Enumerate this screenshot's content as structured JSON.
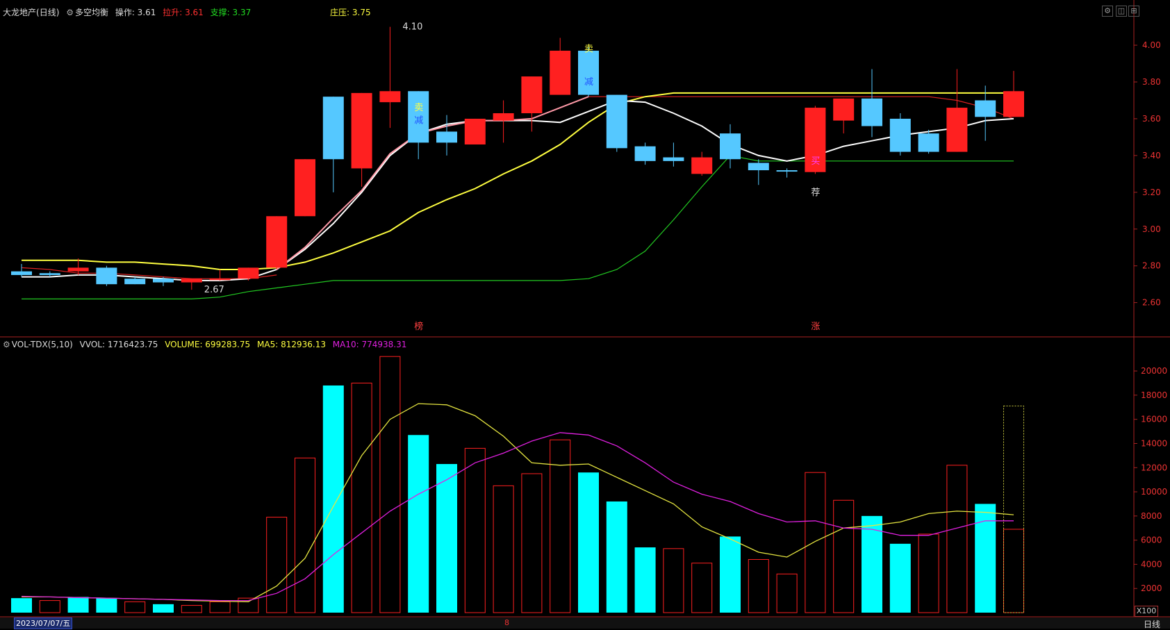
{
  "main_header": {
    "stock": "大龙地产",
    "period": "(日线)",
    "indicator": "多空均衡",
    "operate": "操作: 3.61",
    "pull": "拉升: 3.61",
    "support": "支撑: 3.37",
    "dealer": "庄压: 3.75"
  },
  "vol_header": {
    "name": "VOL-TDX(5,10)",
    "vvol": "VVOL: 1716423.75",
    "volume": "VOLUME: 699283.75",
    "ma5": "MA5: 812936.13",
    "ma10": "MA10: 774938.31"
  },
  "footer": {
    "date": "2023/07/07/五",
    "month_tick": "8",
    "period_label": "日线",
    "unit": "X100"
  },
  "colors": {
    "up": "#ff2020",
    "down": "#55c8ff",
    "vol_down": "#00ffff",
    "ma_white": "#ffffff",
    "ma_yellow": "#ffff40",
    "support_green": "#22cc22",
    "ma5": "#e6e640",
    "ma10": "#e020e0",
    "axis": "#aa2222"
  },
  "chart_data": [
    {
      "type": "candlestick",
      "title": "大龙地产 (日线) 多空均衡",
      "ylim": [
        2.44,
        4.14
      ],
      "y_ticks": [
        2.6,
        2.8,
        3.0,
        3.2,
        3.4,
        3.6,
        3.8,
        4.0
      ],
      "y_tick_labels": [
        "2.60",
        "2.80",
        "3.00",
        "3.20",
        "3.40",
        "3.60",
        "3.80",
        "4.00"
      ],
      "candles": [
        {
          "o": 2.77,
          "h": 2.81,
          "l": 2.74,
          "c": 2.75,
          "dir": "down"
        },
        {
          "o": 2.76,
          "h": 2.77,
          "l": 2.74,
          "c": 2.75,
          "dir": "down"
        },
        {
          "o": 2.79,
          "h": 2.84,
          "l": 2.75,
          "c": 2.77,
          "dir": "up"
        },
        {
          "o": 2.79,
          "h": 2.8,
          "l": 2.69,
          "c": 2.7,
          "dir": "down"
        },
        {
          "o": 2.73,
          "h": 2.74,
          "l": 2.7,
          "c": 2.7,
          "dir": "down"
        },
        {
          "o": 2.73,
          "h": 2.74,
          "l": 2.69,
          "c": 2.71,
          "dir": "down"
        },
        {
          "o": 2.71,
          "h": 2.73,
          "l": 2.67,
          "c": 2.73,
          "dir": "up"
        },
        {
          "o": 2.73,
          "h": 2.78,
          "l": 2.72,
          "c": 2.73,
          "dir": "up"
        },
        {
          "o": 2.73,
          "h": 2.79,
          "l": 2.72,
          "c": 2.79,
          "dir": "up"
        },
        {
          "o": 2.79,
          "h": 3.07,
          "l": 2.78,
          "c": 3.07,
          "dir": "up"
        },
        {
          "o": 3.07,
          "h": 3.38,
          "l": 3.07,
          "c": 3.38,
          "dir": "up"
        },
        {
          "o": 3.72,
          "h": 3.72,
          "l": 3.2,
          "c": 3.38,
          "dir": "down"
        },
        {
          "o": 3.33,
          "h": 3.74,
          "l": 3.23,
          "c": 3.74,
          "dir": "up"
        },
        {
          "o": 3.69,
          "h": 4.1,
          "l": 3.55,
          "c": 3.75,
          "dir": "up"
        },
        {
          "o": 3.75,
          "h": 3.75,
          "l": 3.38,
          "c": 3.47,
          "dir": "down"
        },
        {
          "o": 3.53,
          "h": 3.62,
          "l": 3.4,
          "c": 3.47,
          "dir": "down"
        },
        {
          "o": 3.46,
          "h": 3.6,
          "l": 3.46,
          "c": 3.6,
          "dir": "up"
        },
        {
          "o": 3.59,
          "h": 3.7,
          "l": 3.47,
          "c": 3.63,
          "dir": "up"
        },
        {
          "o": 3.63,
          "h": 3.83,
          "l": 3.53,
          "c": 3.83,
          "dir": "up"
        },
        {
          "o": 3.73,
          "h": 4.04,
          "l": 3.73,
          "c": 3.97,
          "dir": "up"
        },
        {
          "o": 3.97,
          "h": 3.99,
          "l": 3.72,
          "c": 3.73,
          "dir": "down"
        },
        {
          "o": 3.73,
          "h": 3.73,
          "l": 3.42,
          "c": 3.44,
          "dir": "down"
        },
        {
          "o": 3.45,
          "h": 3.47,
          "l": 3.35,
          "c": 3.37,
          "dir": "down"
        },
        {
          "o": 3.39,
          "h": 3.47,
          "l": 3.34,
          "c": 3.37,
          "dir": "down"
        },
        {
          "o": 3.3,
          "h": 3.42,
          "l": 3.29,
          "c": 3.39,
          "dir": "up"
        },
        {
          "o": 3.52,
          "h": 3.57,
          "l": 3.33,
          "c": 3.38,
          "dir": "down"
        },
        {
          "o": 3.36,
          "h": 3.38,
          "l": 3.24,
          "c": 3.32,
          "dir": "down"
        },
        {
          "o": 3.32,
          "h": 3.33,
          "l": 3.28,
          "c": 3.32,
          "dir": "down"
        },
        {
          "o": 3.31,
          "h": 3.67,
          "l": 3.3,
          "c": 3.66,
          "dir": "up"
        },
        {
          "o": 3.59,
          "h": 3.71,
          "l": 3.52,
          "c": 3.71,
          "dir": "up"
        },
        {
          "o": 3.71,
          "h": 3.87,
          "l": 3.5,
          "c": 3.56,
          "dir": "down"
        },
        {
          "o": 3.6,
          "h": 3.63,
          "l": 3.4,
          "c": 3.42,
          "dir": "down"
        },
        {
          "o": 3.52,
          "h": 3.54,
          "l": 3.41,
          "c": 3.42,
          "dir": "down"
        },
        {
          "o": 3.42,
          "h": 3.87,
          "l": 3.42,
          "c": 3.66,
          "dir": "up"
        },
        {
          "o": 3.7,
          "h": 3.78,
          "l": 3.48,
          "c": 3.61,
          "dir": "down"
        },
        {
          "o": 3.61,
          "h": 3.86,
          "l": 3.61,
          "c": 3.75,
          "dir": "up"
        }
      ],
      "ma_white": [
        2.74,
        2.74,
        2.75,
        2.75,
        2.74,
        2.73,
        2.72,
        2.72,
        2.73,
        2.78,
        2.89,
        3.03,
        3.2,
        3.4,
        3.52,
        3.57,
        3.59,
        3.59,
        3.59,
        3.58,
        3.64,
        3.7,
        3.69,
        3.63,
        3.56,
        3.46,
        3.4,
        3.37,
        3.4,
        3.45,
        3.48,
        3.51,
        3.53,
        3.55,
        3.59,
        3.6
      ],
      "ma_yellow": [
        2.83,
        2.83,
        2.83,
        2.82,
        2.82,
        2.81,
        2.8,
        2.78,
        2.78,
        2.79,
        2.82,
        2.87,
        2.93,
        2.99,
        3.09,
        3.16,
        3.22,
        3.3,
        3.37,
        3.46,
        3.58,
        3.68,
        3.72,
        3.74,
        3.74,
        3.74,
        3.74,
        3.74,
        3.74,
        3.74,
        3.74,
        3.74,
        3.74,
        3.74,
        3.74,
        3.74
      ],
      "ma_red": [
        2.79,
        2.78,
        2.76,
        2.76,
        2.75,
        2.74,
        2.73,
        2.73,
        2.73,
        2.75,
        null,
        null,
        null,
        null,
        null,
        null,
        null,
        null,
        null,
        null,
        3.72,
        3.72,
        3.72,
        3.72,
        3.72,
        3.72,
        3.72,
        3.72,
        3.72,
        3.72,
        3.72,
        3.72,
        3.72,
        3.7,
        3.66,
        3.6
      ],
      "ma_pink": [
        null,
        null,
        null,
        null,
        null,
        null,
        null,
        null,
        null,
        2.78,
        2.9,
        3.06,
        3.21,
        3.41,
        3.52,
        3.56,
        3.59,
        3.59,
        3.6,
        3.66,
        3.72
      ],
      "support_green": [
        2.62,
        2.62,
        2.62,
        2.62,
        2.62,
        2.62,
        2.62,
        2.63,
        2.66,
        2.68,
        2.7,
        2.72,
        2.72,
        2.72,
        2.72,
        2.72,
        2.72,
        2.72,
        2.72,
        2.72,
        2.73,
        2.78,
        2.88,
        3.05,
        3.23,
        3.4,
        3.37,
        3.37,
        3.37,
        3.37,
        3.37,
        3.37,
        3.37,
        3.37,
        3.37,
        3.37
      ],
      "annotations": [
        {
          "text": "4.10",
          "candle": 13,
          "y": 4.1
        },
        {
          "text": "2.67",
          "candle": 6,
          "y": 2.67
        },
        {
          "text": "卖",
          "candle": 14,
          "y": 3.66
        },
        {
          "text": "减",
          "candle": 14,
          "y": 3.59
        },
        {
          "text": "卖",
          "candle": 20,
          "y": 3.98
        },
        {
          "text": "减",
          "candle": 20,
          "y": 3.8
        },
        {
          "text": "荐",
          "candle": 28,
          "y": 3.2
        },
        {
          "text": "买",
          "candle": 28,
          "y": 3.37
        },
        {
          "text": "榜",
          "candle": 14,
          "y": 2.47
        },
        {
          "text": "涨",
          "candle": 28,
          "y": 2.47
        }
      ]
    },
    {
      "type": "bar",
      "title": "VOL-TDX(5,10)",
      "unit": "X100",
      "ylim": [
        0,
        21500
      ],
      "y_ticks": [
        2000,
        4000,
        6000,
        8000,
        10000,
        12000,
        14000,
        16000,
        18000,
        20000
      ],
      "y_tick_labels": [
        "2000",
        "4000",
        "6000",
        "8000",
        "10000",
        "12000",
        "14000",
        "16000",
        "18000",
        "20000"
      ],
      "volume": [
        1200,
        1000,
        1300,
        1200,
        900,
        700,
        600,
        900,
        1200,
        7900,
        12800,
        18800,
        19000,
        21200,
        14700,
        12300,
        13600,
        10500,
        11500,
        14300,
        11600,
        9200,
        5400,
        5300,
        4100,
        6300,
        4400,
        3200,
        11600,
        9300,
        8000,
        5700,
        6500,
        12200,
        9000,
        6900
      ],
      "volume_dir": [
        "down",
        "up",
        "down",
        "down",
        "up",
        "down",
        "up",
        "up",
        "up",
        "up",
        "up",
        "down",
        "up",
        "up",
        "down",
        "down",
        "up",
        "up",
        "up",
        "up",
        "down",
        "down",
        "down",
        "up",
        "up",
        "down",
        "up",
        "up",
        "up",
        "up",
        "down",
        "down",
        "up",
        "up",
        "down",
        "up"
      ],
      "pending_volume": 17100,
      "ma5": [
        1300,
        1300,
        1250,
        1200,
        1150,
        1100,
        1000,
        950,
        900,
        2200,
        4500,
        8800,
        13000,
        16000,
        17300,
        17200,
        16300,
        14600,
        12400,
        12200,
        12300,
        11200,
        10100,
        9000,
        7100,
        6100,
        5000,
        4600,
        5900,
        7000,
        7200,
        7500,
        8200,
        8400,
        8300,
        8100
      ],
      "ma10": [
        1350,
        1300,
        1250,
        1200,
        1150,
        1100,
        1050,
        1000,
        1000,
        1600,
        2800,
        4800,
        6600,
        8400,
        9800,
        11000,
        12400,
        13200,
        14200,
        14900,
        14700,
        13800,
        12400,
        10800,
        9800,
        9200,
        8200,
        7500,
        7600,
        7000,
        6900,
        6400,
        6400,
        7000,
        7600,
        7600
      ]
    }
  ]
}
